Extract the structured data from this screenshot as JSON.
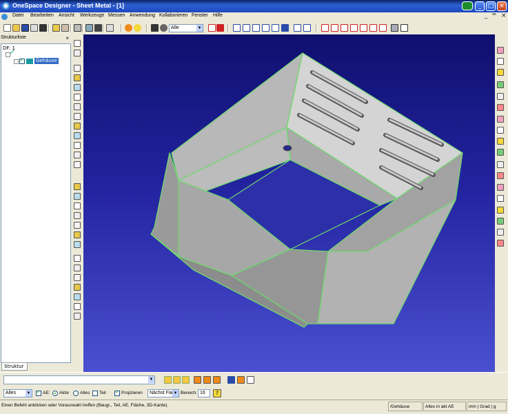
{
  "window": {
    "title": "OneSpace Designer - Sheet Metal - [1]",
    "controls": {
      "minimize": "_",
      "maximize": "□",
      "close": "×"
    }
  },
  "menu": {
    "items": [
      "Datei",
      "Bearbeiten",
      "Ansicht",
      "Werkzeuge",
      "Messen",
      "Anwendung",
      "Kollaborieren",
      "Fenster",
      "Hilfe"
    ],
    "mdi_controls": {
      "minimize": "_",
      "restore": "ꟹ",
      "close": "×"
    }
  },
  "toolbar": {
    "filter_value": "Alle",
    "filter_arrow": "▼"
  },
  "structure_browser": {
    "title": "Strukturliste",
    "close": "×",
    "root": "DF: 1",
    "part_label": "Gehäuse",
    "tab_label": "Struktur"
  },
  "bottom": {
    "command_input": "",
    "scope_select": "Alles",
    "ae_label": "AE:",
    "option_active": "Aktiv",
    "option_all": "Alles",
    "part_label": "Teil",
    "project_label": "Projizieren",
    "nearest_select": "Nächst Fan",
    "range_label": "Bereich:",
    "range_value": "16",
    "help_icon": "?"
  },
  "status": {
    "prompt": "Einen Befehl anklicken oder Vorauswahl treffen (Baugr., Teil, AE, Fläche, 3D-Kante).",
    "part": "/Gehäuse",
    "workplane": "Alles in akt AE",
    "units": "mm | Grad | g"
  },
  "colors": {
    "viewport_top": "#0f0f6e",
    "viewport_bottom": "#4a50d0",
    "part_face": "#c8c8c8",
    "part_edge": "#6fd86f",
    "titlebar": "#1c48c0"
  }
}
